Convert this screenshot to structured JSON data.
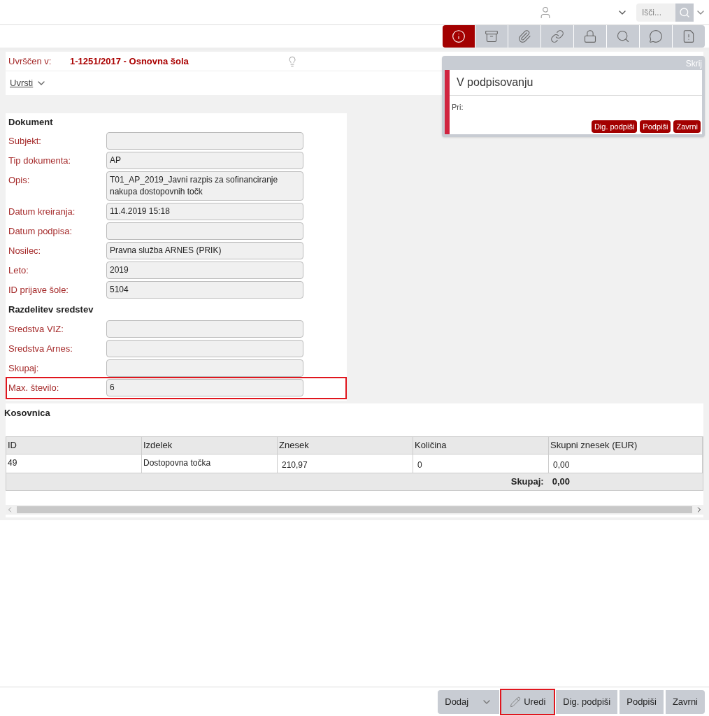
{
  "top_bar": {
    "search": {
      "placeholder": "Išči..."
    }
  },
  "toolbar": [
    {
      "selected": true
    },
    {
      "selected": false
    },
    {
      "selected": false
    },
    {
      "selected": false
    },
    {
      "selected": false
    },
    {
      "selected": false
    },
    {
      "selected": false
    },
    {
      "selected": false
    }
  ],
  "classification": {
    "label": "Uvrščen v:",
    "value": "1-1251/2017 - Osnovna šola",
    "action": "Uvrsti"
  },
  "form": {
    "title": "Dokument",
    "rows": [
      {
        "kind": "field",
        "label": "Subjekt:",
        "value": "",
        "highlighted": false
      },
      {
        "kind": "field",
        "label": "Tip dokumenta:",
        "value": "AP",
        "highlighted": false
      },
      {
        "kind": "field",
        "label": "Opis:",
        "value": "T01_AP_2019_Javni razpis za sofinanciranje nakupa dostopovnih točk",
        "highlighted": false
      },
      {
        "kind": "field",
        "label": "Datum kreiranja:",
        "value": "11.4.2019 15:18",
        "highlighted": false
      },
      {
        "kind": "field",
        "label": "Datum podpisa:",
        "value": "",
        "highlighted": false
      },
      {
        "kind": "field",
        "label": "Nosilec:",
        "value": "Pravna služba ARNES (PRIK)",
        "highlighted": false
      },
      {
        "kind": "field",
        "label": "Leto:",
        "value": "2019",
        "highlighted": false
      },
      {
        "kind": "field",
        "label": "ID prijave šole:",
        "value": "5104",
        "highlighted": false
      },
      {
        "kind": "section",
        "label": "Razdelitev sredstev"
      },
      {
        "kind": "field",
        "label": "Sredstva VIZ:",
        "value": "",
        "highlighted": false
      },
      {
        "kind": "field",
        "label": "Sredstva Arnes:",
        "value": "",
        "highlighted": false
      },
      {
        "kind": "field",
        "label": "Skupaj:",
        "value": "",
        "highlighted": false
      },
      {
        "kind": "field",
        "label": "Max. število:",
        "value": "6",
        "highlighted": true
      }
    ]
  },
  "status_panel": {
    "hide": "Skrij",
    "title": "V podpisovanju",
    "note": "Pri:",
    "buttons": [
      "Dig. podpiši",
      "Podpiši",
      "Zavrni"
    ]
  },
  "table": {
    "title": "Kosovnica",
    "columns": [
      "ID",
      "Izdelek",
      "Znesek",
      "Količina",
      "Skupni znesek (EUR)"
    ],
    "rows": [
      [
        "49",
        "Dostopovna točka",
        "210,97",
        "0",
        "0,00"
      ]
    ],
    "total_label": "Skupaj:",
    "total_value": "0,00"
  },
  "bottom_bar": {
    "buttons": [
      {
        "label": "Dodaj",
        "kind": "dropdown",
        "highlighted": false
      },
      {
        "label": "Uredi",
        "kind": "edit",
        "highlighted": true
      },
      {
        "label": "Dig. podpiši",
        "kind": "plain",
        "highlighted": false
      },
      {
        "label": "Podpiši",
        "kind": "plain",
        "highlighted": false
      },
      {
        "label": "Zavrni",
        "kind": "plain",
        "highlighted": false
      }
    ]
  }
}
